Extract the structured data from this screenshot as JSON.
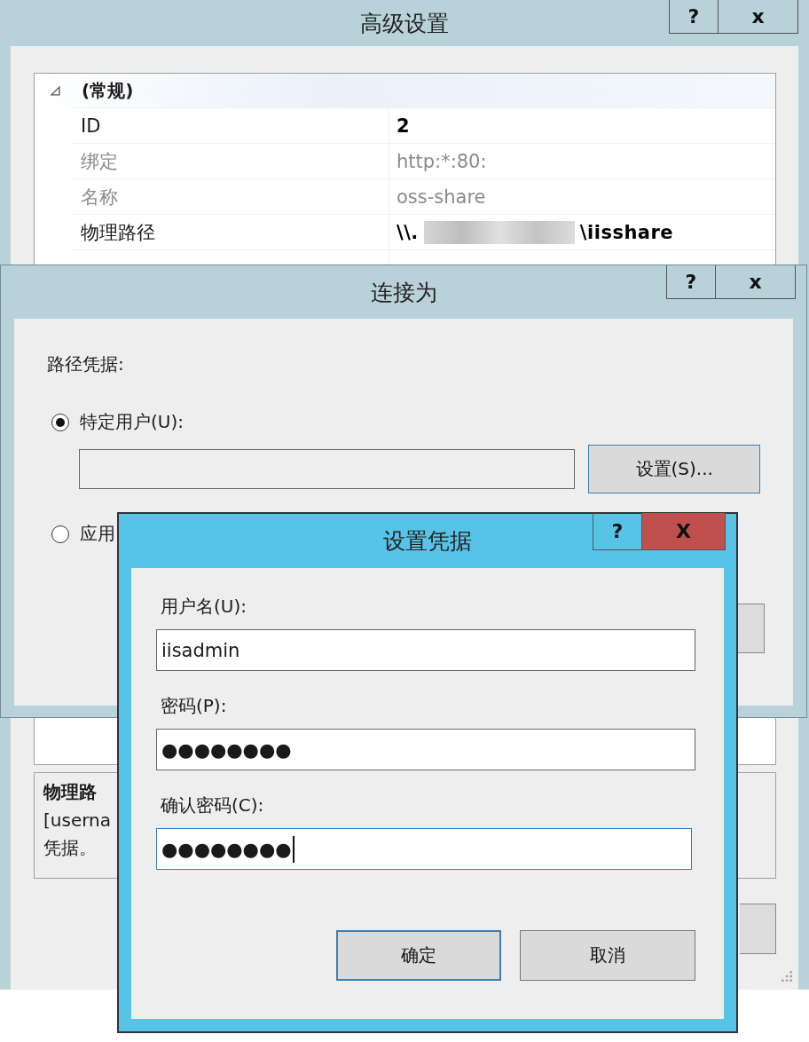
{
  "settings_window": {
    "title": "高级设置",
    "help_button": "?",
    "close_button": "x",
    "property_grid": {
      "category": {
        "label": "(常规)",
        "expanded": true
      },
      "rows": [
        {
          "name": "ID",
          "value": "2",
          "disabled": false,
          "modified": true
        },
        {
          "name": "绑定",
          "value": "http:*:80:",
          "disabled": true,
          "modified": false
        },
        {
          "name": "名称",
          "value": "oss-share",
          "disabled": true,
          "modified": false
        },
        {
          "name": "物理路径",
          "value": "\\\\.",
          "redacted": true,
          "value_end": "\\iisshare",
          "disabled": false,
          "modified": true
        }
      ]
    },
    "description": {
      "title": "物理路",
      "lines": [
        "[userna",
        "凭据。"
      ]
    }
  },
  "connect_window": {
    "title": "连接为",
    "help_button": "?",
    "close_button": "x",
    "group_label": "路径凭据:",
    "options": [
      {
        "label": "特定用户(U):",
        "selected": true
      },
      {
        "label": "应用",
        "selected": false
      }
    ],
    "set_button": "设置(S)..."
  },
  "credentials_window": {
    "title": "设置凭据",
    "help_button": "?",
    "close_button": "X",
    "fields": [
      {
        "label": "用户名(U):",
        "value": "iisadmin",
        "focused": false
      },
      {
        "label": "密码(P):",
        "value": "●●●●●●●●",
        "focused": false
      },
      {
        "label": "确认密码(C):",
        "value": "●●●●●●●●",
        "focused": true
      }
    ],
    "buttons": [
      {
        "label": "确定",
        "default": true
      },
      {
        "label": "取消",
        "default": false
      }
    ]
  }
}
